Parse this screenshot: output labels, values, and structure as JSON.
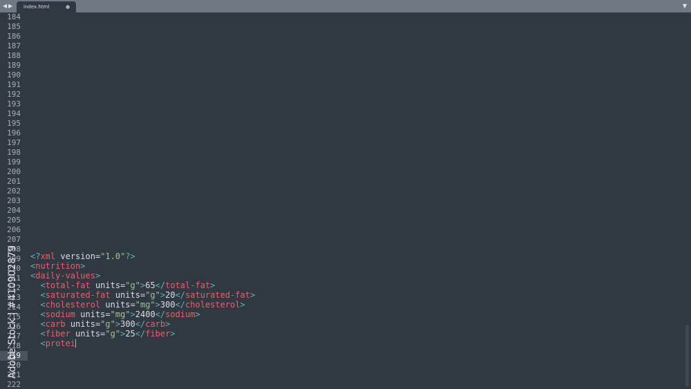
{
  "tabbar": {
    "arrow_left": "◀",
    "arrow_right": "▶",
    "tab_label": "index.html",
    "tab_close": "●",
    "menu_icon": "▼"
  },
  "editor": {
    "line_numbers": [
      "184",
      "185",
      "186",
      "187",
      "188",
      "189",
      "190",
      "191",
      "192",
      "193",
      "194",
      "195",
      "196",
      "197",
      "198",
      "199",
      "200",
      "201",
      "202",
      "203",
      "204",
      "205",
      "206",
      "207",
      "208",
      "209",
      "210",
      "211",
      "212",
      "213",
      "214",
      "215",
      "216",
      "217",
      "218",
      "219",
      "220",
      "221",
      "222"
    ],
    "active_line": "219",
    "code": {
      "l1": {
        "open": "<?",
        "tag": "xml",
        "attr": " version=",
        "str": "\"1.0\"",
        "close": "?>"
      },
      "l2": {
        "open": "<",
        "tag": "nutrition",
        "close": ">"
      },
      "l3": {
        "open": "<",
        "tag": "daily-values",
        "close": ">"
      },
      "l4": {
        "open": "<",
        "tag": "total-fat",
        "attr": " units=",
        "str": "\"g\"",
        "close": ">",
        "value": "65",
        "eopen": "</",
        "etag": "total-fat",
        "eclose": ">"
      },
      "l5": {
        "open": "<",
        "tag": "saturated-fat",
        "attr": " units=",
        "str": "\"g\"",
        "close": ">",
        "value": "20",
        "eopen": "</",
        "etag": "saturated-fat",
        "eclose": ">"
      },
      "l6": {
        "open": "<",
        "tag": "cholesterol",
        "attr": " units=",
        "str": "\"mg\"",
        "close": ">",
        "value": "300",
        "eopen": "</",
        "etag": "cholesterol",
        "eclose": ">"
      },
      "l7": {
        "open": "<",
        "tag": "sodium",
        "attr": " units=",
        "str": "\"mg\"",
        "close": ">",
        "value": "2400",
        "eopen": "</",
        "etag": "sodium",
        "eclose": ">"
      },
      "l8": {
        "open": "<",
        "tag": "carb",
        "attr": " units=",
        "str": "\"g\"",
        "close": ">",
        "value": "300",
        "eopen": "</",
        "etag": "carb",
        "eclose": ">"
      },
      "l9": {
        "open": "<",
        "tag": "fiber",
        "attr": " units=",
        "str": "\"g\"",
        "close": ">",
        "value": "25",
        "eopen": "</",
        "etag": "fiber",
        "eclose": ">"
      },
      "l10": {
        "open": "<",
        "tag": "protei"
      }
    }
  },
  "watermark": {
    "text": "Adobe Stock | #410902879"
  },
  "colors": {
    "background": "#303841",
    "tabbar": "#6f7883",
    "tag": "#ec5f66",
    "string": "#99c794",
    "punctuation": "#5fb4b4",
    "cursor": "#f9ae58"
  }
}
